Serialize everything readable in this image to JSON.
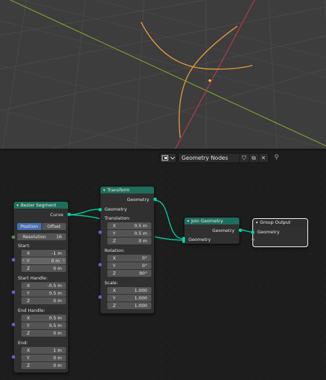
{
  "colors": {
    "viewport_bg": "#3d3d3d",
    "x_axis": "#c0384a",
    "y_axis": "#7fa332",
    "curve": "#e49a3c",
    "geometry_socket": "#00d6a3",
    "vector_socket": "#6363c7",
    "int_socket": "#598c5c",
    "node_header": "#1f6e5c",
    "selection": "#ffffff"
  },
  "header": {
    "editor_type_icon": "node-editor-icon",
    "node_tree_name": "Geometry Nodes",
    "icons": [
      "shield-icon",
      "copy-icon",
      "close-icon",
      "pin-icon"
    ]
  },
  "nodes": {
    "bezier": {
      "title": "Bezier Segment",
      "output_curve": "Curve",
      "mode_position": "Position",
      "mode_offset": "Offset",
      "resolution_label": "Resolution",
      "resolution_value": "16",
      "start_label": "Start:",
      "start": [
        {
          "axis": "X",
          "value": "-1 m"
        },
        {
          "axis": "Y",
          "value": "0 m"
        },
        {
          "axis": "Z",
          "value": "0 m"
        }
      ],
      "start_handle_label": "Start Handle:",
      "start_handle": [
        {
          "axis": "X",
          "value": "-0.5 m"
        },
        {
          "axis": "Y",
          "value": "0.5 m"
        },
        {
          "axis": "Z",
          "value": "0 m"
        }
      ],
      "end_handle_label": "End Handle:",
      "end_handle": [
        {
          "axis": "X",
          "value": "0.5 m"
        },
        {
          "axis": "Y",
          "value": "0.5 m"
        },
        {
          "axis": "Z",
          "value": "0 m"
        }
      ],
      "end_label": "End:",
      "end": [
        {
          "axis": "X",
          "value": "1 m"
        },
        {
          "axis": "Y",
          "value": "0 m"
        },
        {
          "axis": "Z",
          "value": "0 m"
        }
      ]
    },
    "transform": {
      "title": "Transform",
      "output_geometry": "Geometry",
      "input_geometry": "Geometry",
      "translation_label": "Translation:",
      "translation": [
        {
          "axis": "X",
          "value": "0.5 m"
        },
        {
          "axis": "Y",
          "value": "0.5 m"
        },
        {
          "axis": "Z",
          "value": "0 m"
        }
      ],
      "rotation_label": "Rotation:",
      "rotation": [
        {
          "axis": "X",
          "value": "0°"
        },
        {
          "axis": "Y",
          "value": "0°"
        },
        {
          "axis": "Z",
          "value": "90°"
        }
      ],
      "scale_label": "Scale:",
      "scale": [
        {
          "axis": "X",
          "value": "1.000"
        },
        {
          "axis": "Y",
          "value": "1.000"
        },
        {
          "axis": "Z",
          "value": "1.000"
        }
      ]
    },
    "join": {
      "title": "Join Geometry",
      "output_geometry": "Geometry",
      "input_geometry": "Geometry"
    },
    "output": {
      "title": "Group Output",
      "input_geometry": "Geometry"
    }
  }
}
